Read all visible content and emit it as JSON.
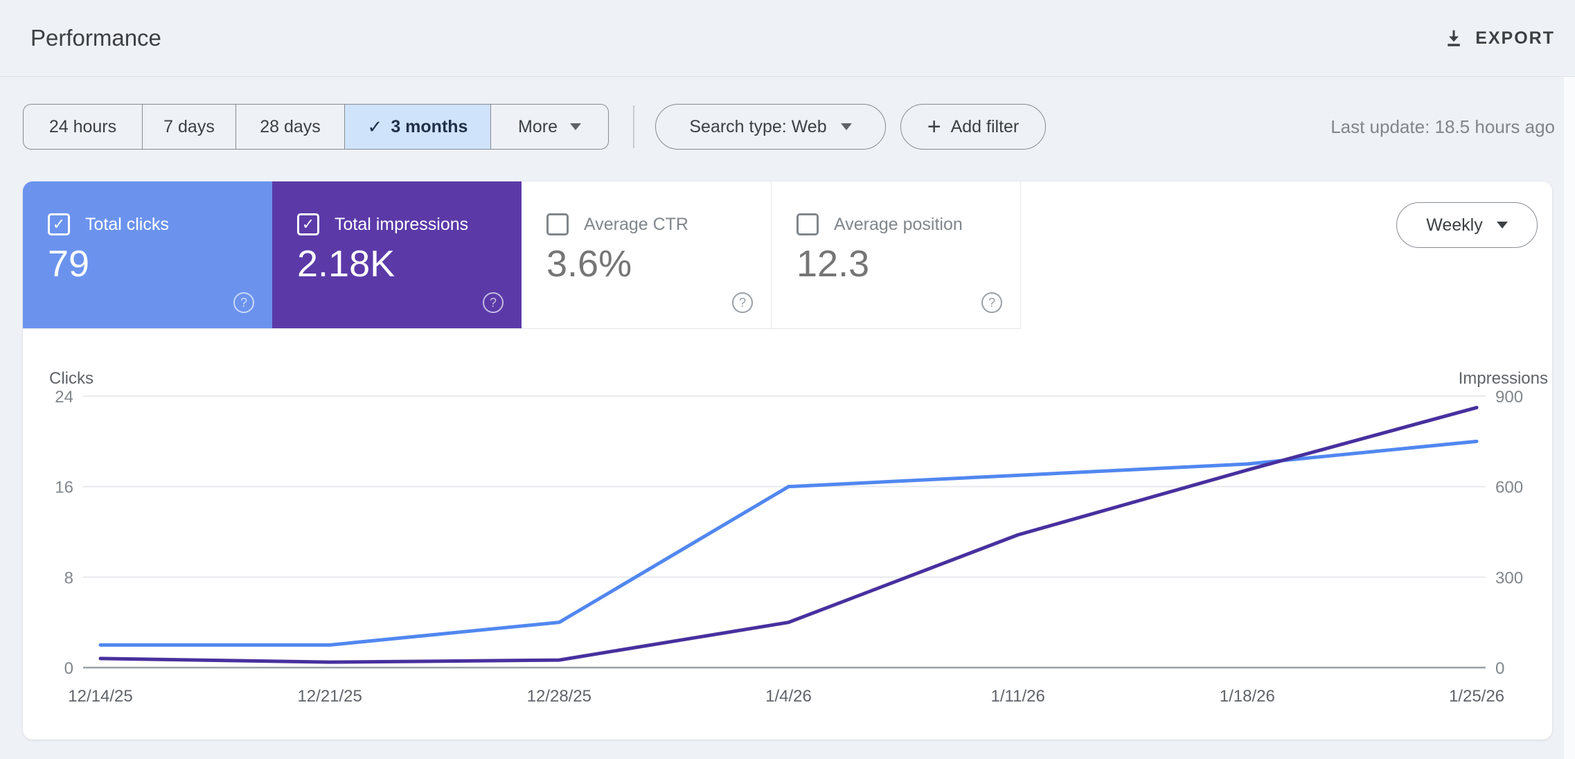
{
  "header": {
    "title": "Performance",
    "export_label": "EXPORT"
  },
  "filters": {
    "date_ranges": [
      {
        "label": "24 hours",
        "selected": false
      },
      {
        "label": "7 days",
        "selected": false
      },
      {
        "label": "28 days",
        "selected": false
      },
      {
        "label": "3 months",
        "selected": true
      }
    ],
    "more_label": "More",
    "search_type_label": "Search type: Web",
    "add_filter_label": "Add filter",
    "last_update": "Last update: 18.5 hours ago"
  },
  "metrics": [
    {
      "label": "Total clicks",
      "value": "79",
      "checked": true,
      "color": "#6b93ee"
    },
    {
      "label": "Total impressions",
      "value": "2.18K",
      "checked": true,
      "color": "#5b3aa8"
    },
    {
      "label": "Average CTR",
      "value": "3.6%",
      "checked": false,
      "color": null
    },
    {
      "label": "Average position",
      "value": "12.3",
      "checked": false,
      "color": null
    }
  ],
  "granularity_label": "Weekly",
  "glyphs": {
    "check": "✓",
    "plus": "+",
    "question": "?"
  },
  "colors": {
    "clicks_line": "#5187f0",
    "impressions_line": "#47309e",
    "selected_chip_bg": "#cfe3fb",
    "gridline": "#e8eaed",
    "axis_line": "#9aa0a6"
  },
  "chart_data": {
    "type": "line",
    "x": [
      "12/14/25",
      "12/21/25",
      "12/28/25",
      "1/4/26",
      "1/11/26",
      "1/18/26",
      "1/25/26"
    ],
    "series": [
      {
        "name": "Clicks",
        "axis": "left",
        "color": "#5187f0",
        "values": [
          2,
          2,
          4,
          16,
          17,
          18,
          20
        ]
      },
      {
        "name": "Impressions",
        "axis": "right",
        "color": "#47309e",
        "values": [
          30,
          18,
          25,
          150,
          440,
          655,
          862
        ]
      }
    ],
    "left_axis": {
      "title": "Clicks",
      "ticks": [
        0,
        8,
        16,
        24
      ],
      "max": 24
    },
    "right_axis": {
      "title": "Impressions",
      "ticks": [
        0,
        300,
        600,
        900
      ],
      "max": 900
    },
    "grid": true,
    "legend": "none"
  }
}
